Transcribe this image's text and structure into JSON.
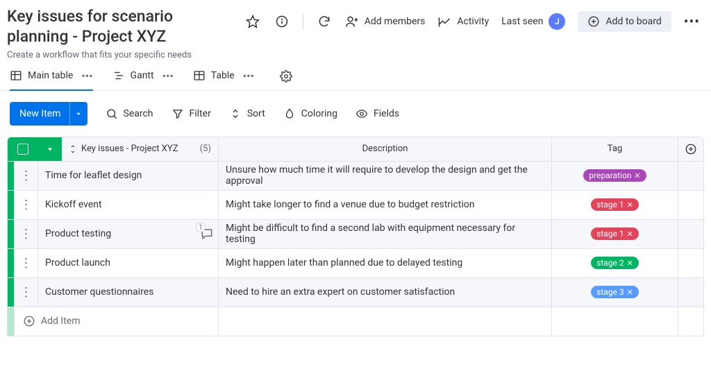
{
  "header": {
    "title": "Key issues for scenario planning - Project XYZ",
    "subtitle": "Create a workflow that fits your specific needs",
    "add_members": "Add members",
    "activity": "Activity",
    "last_seen": "Last seen",
    "avatar_initial": "J",
    "add_to_board": "Add to board"
  },
  "tabs": {
    "main_table": "Main table",
    "gantt": "Gantt",
    "table": "Table"
  },
  "toolbar": {
    "new_item": "New Item",
    "search": "Search",
    "filter": "Filter",
    "sort": "Sort",
    "coloring": "Coloring",
    "fields": "Fields"
  },
  "columns": {
    "name": "Key issues - Project XYZ",
    "count": "(5)",
    "description": "Description",
    "tag": "Tag"
  },
  "tag_colors": {
    "preparation": "#a946b8",
    "stage 1": "#e2445c",
    "stage 2": "#00b461",
    "stage 3": "#579bfc"
  },
  "rows": [
    {
      "name": "Time for leaflet design",
      "description": "Unsure how much time it will require to develop the design and get the approval",
      "tag": "preparation",
      "conversations": 0
    },
    {
      "name": "Kickoff event",
      "description": "Might take longer to find a venue due to budget restriction",
      "tag": "stage 1",
      "conversations": 0
    },
    {
      "name": "Product testing",
      "description": "Might be difficult to find a second lab with equipment necessary for testing",
      "tag": "stage 1",
      "conversations": 1
    },
    {
      "name": "Product launch",
      "description": "Might happen later than planned due to delayed testing",
      "tag": "stage 2",
      "conversations": 0
    },
    {
      "name": "Customer questionnaires",
      "description": "Need to hire an extra expert on customer satisfaction",
      "tag": "stage 3",
      "conversations": 0
    }
  ],
  "add_item": "Add Item"
}
